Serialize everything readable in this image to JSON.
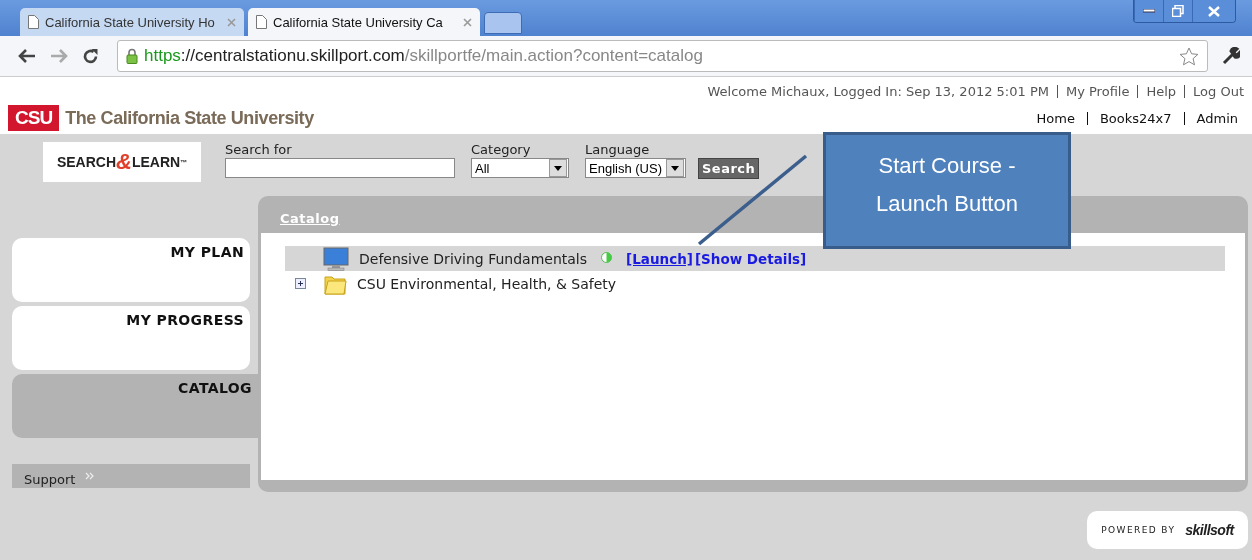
{
  "browser": {
    "tabs": [
      {
        "title": "California State University  Ho",
        "selected": false
      },
      {
        "title": "California State University  Ca",
        "selected": true
      }
    ],
    "address": {
      "scheme": "https",
      "host": "://centralstationu.skillport.com",
      "path": "/skillportfe/main.action?content=catalog"
    }
  },
  "header": {
    "logo_mark": "CSU",
    "logo_text": "The California State University",
    "welcome": "Welcome Michaux, Logged In: Sep 13, 2012 5:01 PM",
    "account_links": [
      "My Profile",
      "Help",
      "Log Out"
    ],
    "nav_links": [
      "Home",
      "Books24x7",
      "Admin"
    ]
  },
  "search": {
    "brand": {
      "left": "SEARCH",
      "amp": "&",
      "right": "LEARN",
      "tm": "™"
    },
    "search_for_label": "Search for",
    "category_label": "Category",
    "category_value": "All",
    "language_label": "Language",
    "language_value": "English (US)",
    "button": "Search"
  },
  "sidebar": {
    "items": [
      {
        "label": "MY PLAN",
        "selected": false
      },
      {
        "label": "MY PROGRESS",
        "selected": false
      },
      {
        "label": "CATALOG",
        "selected": true
      }
    ],
    "support": "Support"
  },
  "catalog": {
    "title": "Catalog",
    "items": [
      {
        "kind": "course",
        "label": "Defensive Driving Fundamentals",
        "highlighted": true,
        "links": [
          "[Launch]",
          "[Show Details]"
        ]
      },
      {
        "kind": "folder",
        "label": "CSU Environmental, Health, & Safety",
        "highlighted": false,
        "expanded": false
      }
    ]
  },
  "callout": {
    "text": "Start Course - Launch Button"
  },
  "footer": {
    "powered_by": "POWERED BY",
    "brand": "skillsoft"
  }
}
